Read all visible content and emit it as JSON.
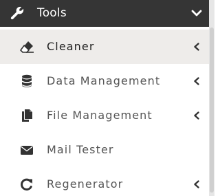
{
  "colors": {
    "header_bg": "#353535",
    "header_text": "#ffffff",
    "active_bg": "#eeecea",
    "item_text": "#555555",
    "icon": "#333333"
  },
  "header": {
    "label": "Tools",
    "icon": "wrench-icon",
    "toggle_icon": "chevron-down-icon"
  },
  "items": [
    {
      "label": "Cleaner",
      "icon": "eraser-icon",
      "active": true,
      "has_submenu": true
    },
    {
      "label": "Data Management",
      "icon": "database-icon",
      "active": false,
      "has_submenu": true
    },
    {
      "label": "File Management",
      "icon": "files-icon",
      "active": false,
      "has_submenu": true
    },
    {
      "label": "Mail Tester",
      "icon": "envelope-icon",
      "active": false,
      "has_submenu": false
    },
    {
      "label": "Regenerator",
      "icon": "redo-icon",
      "active": false,
      "has_submenu": true
    }
  ]
}
